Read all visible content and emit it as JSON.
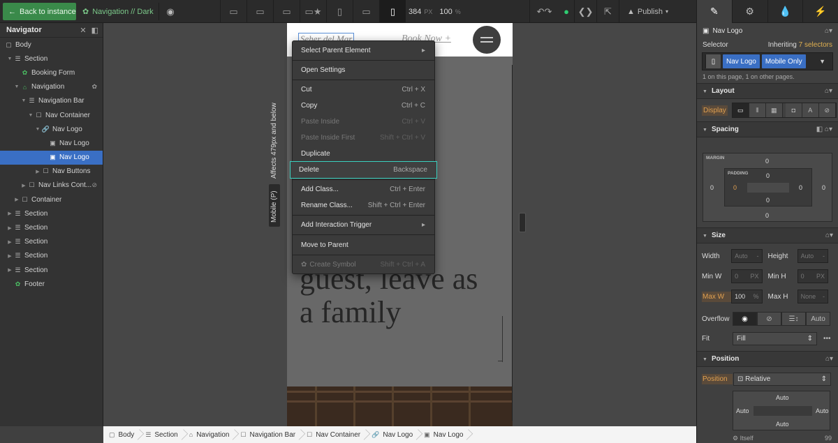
{
  "topbar": {
    "back_label": "Back to instance",
    "symbol_label": "Navigation // Dark",
    "width_value": "384",
    "width_unit": "PX",
    "zoom_value": "100",
    "zoom_unit": "%",
    "publish_label": "Publish",
    "device_icons": [
      "desktop-xl-icon",
      "desktop-large-icon",
      "desktop-icon",
      "desktop-base-star-icon",
      "tablet-icon",
      "mobile-landscape-icon",
      "mobile-portrait-icon"
    ]
  },
  "navigator": {
    "title": "Navigator",
    "items": [
      {
        "label": "Body",
        "depth": 0
      },
      {
        "label": "Section",
        "depth": 1
      },
      {
        "label": "Booking Form",
        "depth": 2
      },
      {
        "label": "Navigation",
        "depth": 2
      },
      {
        "label": "Navigation Bar",
        "depth": 3
      },
      {
        "label": "Nav Container",
        "depth": 4
      },
      {
        "label": "Nav Logo",
        "depth": 5
      },
      {
        "label": "Nav Logo",
        "depth": 6
      },
      {
        "label": "Nav Logo",
        "depth": 6
      },
      {
        "label": "Nav Buttons",
        "depth": 5
      },
      {
        "label": "Nav Links Cont...",
        "depth": 3
      },
      {
        "label": "Container",
        "depth": 2
      },
      {
        "label": "Section",
        "depth": 1
      },
      {
        "label": "Section",
        "depth": 1
      },
      {
        "label": "Section",
        "depth": 1
      },
      {
        "label": "Section",
        "depth": 1
      },
      {
        "label": "Section",
        "depth": 1
      },
      {
        "label": "Footer",
        "depth": 1
      }
    ]
  },
  "canvas": {
    "breakpoint_note": "Affects 479px and below",
    "breakpoint_tag": "Mobile (P)",
    "logo_text": "Seher del Mar",
    "book_text": "Book Now +",
    "hero_lines": [
      "guest, leave as",
      "a family"
    ],
    "hero_partial": "r"
  },
  "context_menu": {
    "items": [
      {
        "label": "Select Parent Element",
        "shortcut": "▸",
        "state": "normal"
      },
      {
        "label": "Open Settings",
        "shortcut": "",
        "state": "normal"
      },
      {
        "label": "Cut",
        "shortcut": "Ctrl + X",
        "state": "normal"
      },
      {
        "label": "Copy",
        "shortcut": "Ctrl + C",
        "state": "normal"
      },
      {
        "label": "Paste Inside",
        "shortcut": "Ctrl + V",
        "state": "disabled"
      },
      {
        "label": "Paste Inside First",
        "shortcut": "Shift + Ctrl + V",
        "state": "disabled"
      },
      {
        "label": "Duplicate",
        "shortcut": "",
        "state": "normal"
      },
      {
        "label": "Delete",
        "shortcut": "Backspace",
        "state": "highlighted"
      },
      {
        "label": "Add Class...",
        "shortcut": "Ctrl + Enter",
        "state": "normal"
      },
      {
        "label": "Rename Class...",
        "shortcut": "Shift + Ctrl + Enter",
        "state": "normal"
      },
      {
        "label": "Add Interaction Trigger",
        "shortcut": "▸",
        "state": "normal"
      },
      {
        "label": "Move to Parent",
        "shortcut": "",
        "state": "normal"
      },
      {
        "label": "Create Symbol",
        "shortcut": "Shift + Ctrl + A",
        "state": "disabled"
      }
    ]
  },
  "breadcrumbs": [
    "Body",
    "Section",
    "Navigation",
    "Navigation Bar",
    "Nav Container",
    "Nav Logo",
    "Nav Logo"
  ],
  "panel": {
    "element_name": "Nav Logo",
    "selector_label": "Selector",
    "inheriting_label": "Inheriting",
    "inheriting_count": "7 selectors",
    "chips": [
      "Nav Logo",
      "Mobile Only"
    ],
    "usage_note": "1 on this page, 1 on other pages.",
    "layout_title": "Layout",
    "display_label": "Display",
    "spacing_title": "Spacing",
    "margin_label": "MARGIN",
    "padding_label": "PADDING",
    "margin": {
      "top": "0",
      "right": "0",
      "bottom": "0",
      "left": "0"
    },
    "padding": {
      "top": "0",
      "right": "0",
      "bottom": "0",
      "left": "0"
    },
    "size_title": "Size",
    "width_label": "Width",
    "width_value": "Auto",
    "height_label": "Height",
    "height_value": "Auto",
    "minw_label": "Min W",
    "minw_value": "0",
    "minw_unit": "PX",
    "minh_label": "Min H",
    "minh_value": "0",
    "minh_unit": "PX",
    "maxw_label": "Max W",
    "maxw_value": "100",
    "maxw_unit": "%",
    "maxh_label": "Max H",
    "maxh_value": "None",
    "overflow_label": "Overflow",
    "overflow_auto": "Auto",
    "fit_label": "Fit",
    "fit_value": "Fill",
    "position_title": "Position",
    "position_label": "Position",
    "position_value": "Relative",
    "pos_top": "Auto",
    "pos_left": "Auto",
    "pos_right": "Auto",
    "pos_bottom": "Auto",
    "itself_label": "Itself",
    "zindex_value": "99"
  },
  "colors": {
    "accent_blue": "#3a6fc4",
    "success_green": "#2ecc71",
    "highlight_teal": "#3ad1c0",
    "back_green": "#3a8a4a"
  }
}
